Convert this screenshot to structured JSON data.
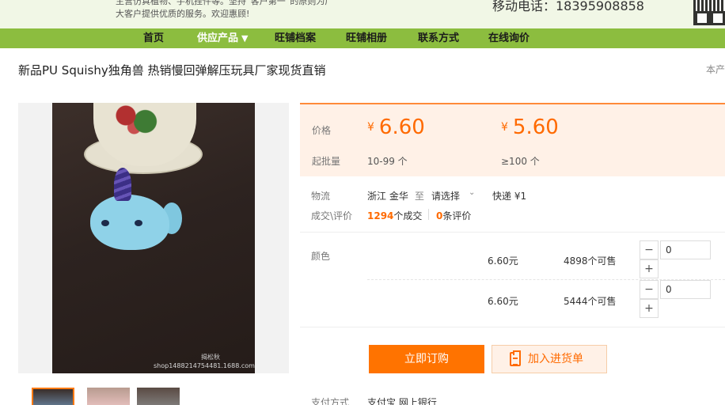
{
  "banner": {
    "intro_line1": "主营仿真植物、手机挂件等。坚持“客户第一”的原则为广",
    "intro_line2": "大客户提供优质的服务。欢迎惠顾!",
    "phone": "移动电话：18395908858"
  },
  "nav": {
    "items": [
      {
        "label": "首页"
      },
      {
        "label": "供应产品",
        "caret": "▼"
      },
      {
        "label": "旺铺档案"
      },
      {
        "label": "旺铺相册"
      },
      {
        "label": "联系方式"
      },
      {
        "label": "在线询价"
      }
    ]
  },
  "product": {
    "title": "新品PU Squishy独角兽 热销慢回弹解压玩具厂家现货直销",
    "title_right": "本产",
    "watermark": "shop1488214754481.1688.com",
    "watermark_top": "揭松秋"
  },
  "price": {
    "label_price": "价格",
    "label_moq": "起批量",
    "currency": "¥",
    "tiers": [
      {
        "price": "6.60",
        "qty": "10-99 个"
      },
      {
        "price": "5.60",
        "qty": "≥100 个"
      }
    ]
  },
  "logistics": {
    "label": "物流",
    "origin": "浙江 金华",
    "to": "至",
    "dest_select": "请选择",
    "shipping": "快递 ¥1"
  },
  "deals": {
    "label": "成交\\评价",
    "count": "1294",
    "count_suffix": "个成交",
    "reviews": "0",
    "reviews_suffix": "条评价"
  },
  "sku": {
    "label": "颜色",
    "rows": [
      {
        "price": "6.60元",
        "stock": "4898个可售",
        "qty": "0"
      },
      {
        "price": "6.60元",
        "stock": "5444个可售",
        "qty": "0"
      }
    ],
    "minus": "−",
    "plus": "+"
  },
  "actions": {
    "buy": "立即订购",
    "cart": "加入进货单"
  },
  "payment": {
    "label": "支付方式",
    "value": "支付宝  网上银行"
  }
}
